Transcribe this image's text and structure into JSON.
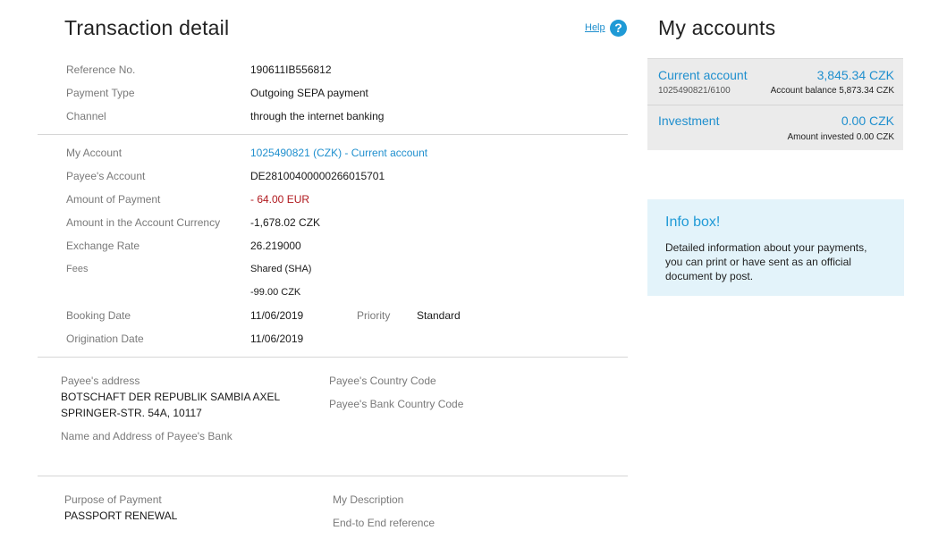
{
  "detail": {
    "title": "Transaction detail",
    "help_label": "Help",
    "help_icon": "?",
    "rows1": [
      {
        "label": "Reference No.",
        "value": "190611IB556812"
      },
      {
        "label": "Payment Type",
        "value": "Outgoing SEPA payment"
      },
      {
        "label": "Channel",
        "value": "through the internet banking"
      }
    ],
    "my_account": {
      "label": "My Account",
      "value": "1025490821 (CZK) - Current account"
    },
    "payee_account": {
      "label": "Payee's Account",
      "value": "DE28100400000266015701"
    },
    "amount_payment": {
      "label": "Amount of Payment",
      "value": "- 64.00 EUR"
    },
    "amount_account_currency": {
      "label": "Amount in the Account Currency",
      "value": "-1,678.02 CZK"
    },
    "exchange_rate": {
      "label": "Exchange Rate",
      "value": "26.219000"
    },
    "fees": {
      "label": "Fees",
      "value": "Shared (SHA)",
      "amount": "-99.00 CZK"
    },
    "booking_date": {
      "label": "Booking Date",
      "value": "11/06/2019"
    },
    "priority": {
      "label": "Priority",
      "value": "Standard"
    },
    "origination_date": {
      "label": "Origination Date",
      "value": "11/06/2019"
    },
    "payee_address": {
      "label": "Payee's address",
      "line1": "BOTSCHAFT DER REPUBLIK SAMBIA AXEL",
      "line2": "SPRINGER-STR. 54A, 10117"
    },
    "payee_bank_name_label": "Name and Address of Payee's Bank",
    "payee_country_code_label": "Payee's Country Code",
    "payee_bank_country_code_label": "Payee's Bank Country Code",
    "purpose": {
      "label": "Purpose of Payment",
      "value": "PASSPORT RENEWAL"
    },
    "my_description_label": "My Description",
    "e2e_reference_label": "End-to End reference"
  },
  "accounts": {
    "title": "My accounts",
    "items": [
      {
        "name": "Current account",
        "amount": "3,845.34 CZK",
        "sub_left": "1025490821/6100",
        "sub_right": "Account balance 5,873.34 CZK"
      },
      {
        "name": "Investment",
        "amount": "0.00 CZK",
        "sub_left": "",
        "sub_right": "Amount invested 0.00 CZK"
      }
    ]
  },
  "info_box": {
    "title": "Info box!",
    "line1": "Detailed information about your payments,",
    "line2": "you can print or have sent as an official",
    "line3": "document by post."
  },
  "colors": {
    "accent": "#1f8fce",
    "negative_amount": "#b0191e",
    "info_box_bg": "#e3f3fa",
    "accounts_panel_bg": "#ebebeb"
  }
}
